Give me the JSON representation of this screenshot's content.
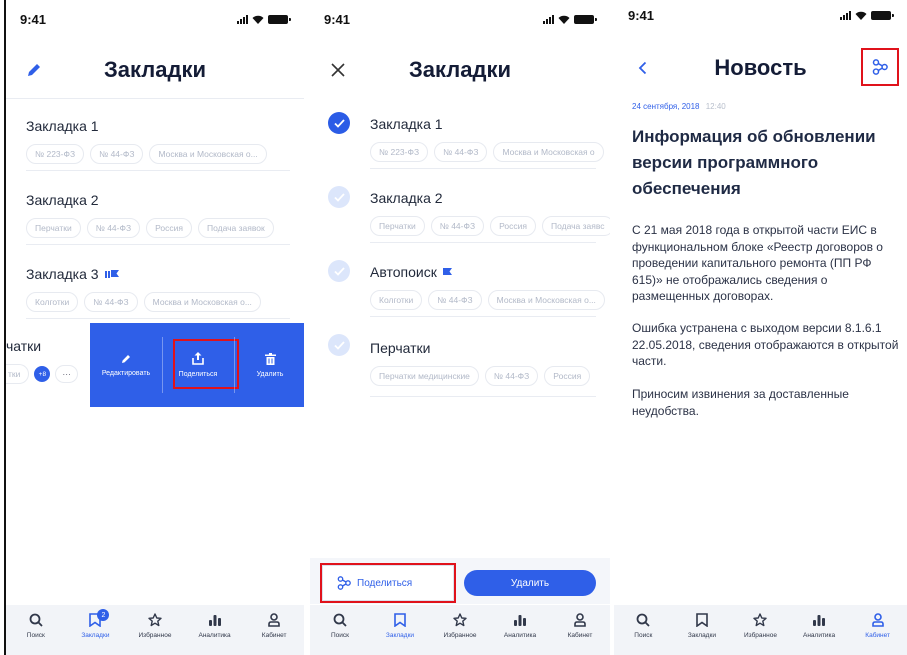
{
  "status": {
    "time": "9:41"
  },
  "screen1": {
    "title": "Закладки",
    "bookmarks": [
      {
        "title": "Закладка 1",
        "tags": [
          "№ 223-ФЗ",
          "№ 44-ФЗ",
          "Москва и Московская о..."
        ]
      },
      {
        "title": "Закладка 2",
        "tags": [
          "Перчатки",
          "№ 44-ФЗ",
          "Россия",
          "Подача заявок"
        ]
      },
      {
        "title": "Закладка 3",
        "tags": [
          "Колготки",
          "№ 44-ФЗ",
          "Москва и Московская о..."
        ]
      }
    ],
    "swiped": {
      "title_fragment": "чатки",
      "tag_fragment": "тки",
      "more_count": "+8",
      "more_dots": "···"
    },
    "actions": {
      "edit": "Редактировать",
      "share": "Поделиться",
      "delete": "Удалить"
    }
  },
  "screen2": {
    "title": "Закладки",
    "items": [
      {
        "title": "Закладка 1",
        "checked": true,
        "tags": [
          "№ 223-ФЗ",
          "№ 44-ФЗ",
          "Москва и Московская о"
        ]
      },
      {
        "title": "Закладка 2",
        "checked": false,
        "tags": [
          "Перчатки",
          "№ 44-ФЗ",
          "Россия",
          "Подача заявс"
        ]
      },
      {
        "title": "Автопоиск",
        "checked": false,
        "tags": [
          "Колготки",
          "№ 44-ФЗ",
          "Москва и Московская о..."
        ]
      },
      {
        "title": "Перчатки",
        "checked": false,
        "tags": [
          "Перчатки медицинские",
          "№ 44-ФЗ",
          "Россия"
        ]
      }
    ],
    "share_label": "Поделиться",
    "delete_label": "Удалить"
  },
  "screen3": {
    "title": "Новость",
    "date": "24 сентября, 2018",
    "time": "12:40",
    "headline": "Информация об обновлении версии программного обеспечения",
    "paragraphs": [
      "С 21 мая 2018 года в открытой части ЕИС в функциональном блоке «Реестр договоров о проведении капитального ремонта (ПП РФ 615)» не отображались сведения о размещенных договорах.",
      "Ошибка устранена с выходом версии 8.1.6.1 22.05.2018, сведения отображаются в открытой части.",
      "Приносим извинения за доставленные неудобства."
    ]
  },
  "tabbar": {
    "tabs": [
      {
        "label": "Поиск",
        "icon": "search-icon"
      },
      {
        "label": "Закладки",
        "icon": "bookmark-icon"
      },
      {
        "label": "Избранное",
        "icon": "star-icon"
      },
      {
        "label": "Аналитика",
        "icon": "chart-icon"
      },
      {
        "label": "Кабинет",
        "icon": "user-icon"
      }
    ],
    "bookmark_badge": "2"
  },
  "colors": {
    "accent": "#2f5fe8",
    "highlight": "#e0121b",
    "tag_text": "#b2b9c8"
  }
}
